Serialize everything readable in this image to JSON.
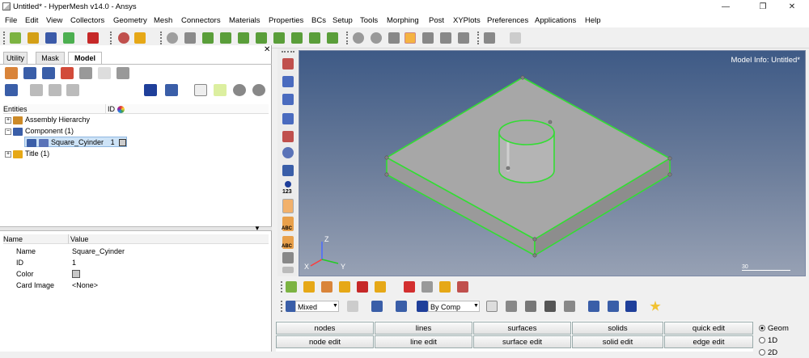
{
  "window": {
    "title": "Untitled* - HyperMesh v14.0 - Ansys"
  },
  "menubar": [
    "File",
    "Edit",
    "View",
    "Collectors",
    "Geometry",
    "Mesh",
    "Connectors",
    "Materials",
    "Properties",
    "BCs",
    "Setup",
    "Tools",
    "Morphing",
    "Post",
    "XYPlots",
    "Preferences",
    "Applications",
    "Help"
  ],
  "left_panel": {
    "tabs": [
      "Utility",
      "Mask",
      "Model"
    ],
    "active_tab": "Model",
    "entities_header": {
      "col1": "Entities",
      "col2": "ID"
    },
    "tree": [
      {
        "label": "Assembly Hierarchy"
      },
      {
        "label": "Component (1)"
      },
      {
        "label": "Square_Cyinder",
        "id": "1"
      },
      {
        "label": "Title (1)"
      }
    ],
    "properties": {
      "header": {
        "name": "Name",
        "value": "Value"
      },
      "rows": [
        {
          "name": "Name",
          "value": "Square_Cyinder"
        },
        {
          "name": "ID",
          "value": "1"
        },
        {
          "name": "Color",
          "value": ""
        },
        {
          "name": "Card Image",
          "value": "<None>"
        }
      ]
    }
  },
  "viewport": {
    "model_info": "Model Info: Untitled*",
    "scale_label": "30",
    "axis_labels": {
      "z": "Z",
      "x": "X",
      "y": "Y"
    },
    "background_top": "#3e5a86",
    "background_bottom": "#97a1b4",
    "edge_color": "#33dd33",
    "surface_color": "#a7a7a7"
  },
  "side_strip": {
    "id_label": "123",
    "abc_label": "ABC"
  },
  "bottom_tools": {
    "entity_mode": "Mixed",
    "color_mode": "By Comp"
  },
  "panel_grid": {
    "row1": [
      "nodes",
      "lines",
      "surfaces",
      "solids",
      "quick edit"
    ],
    "row2": [
      "node edit",
      "line edit",
      "surface edit",
      "solid edit",
      "edge edit"
    ]
  },
  "radio_group": {
    "options": [
      "Geom",
      "1D",
      "2D"
    ],
    "selected": "Geom"
  }
}
